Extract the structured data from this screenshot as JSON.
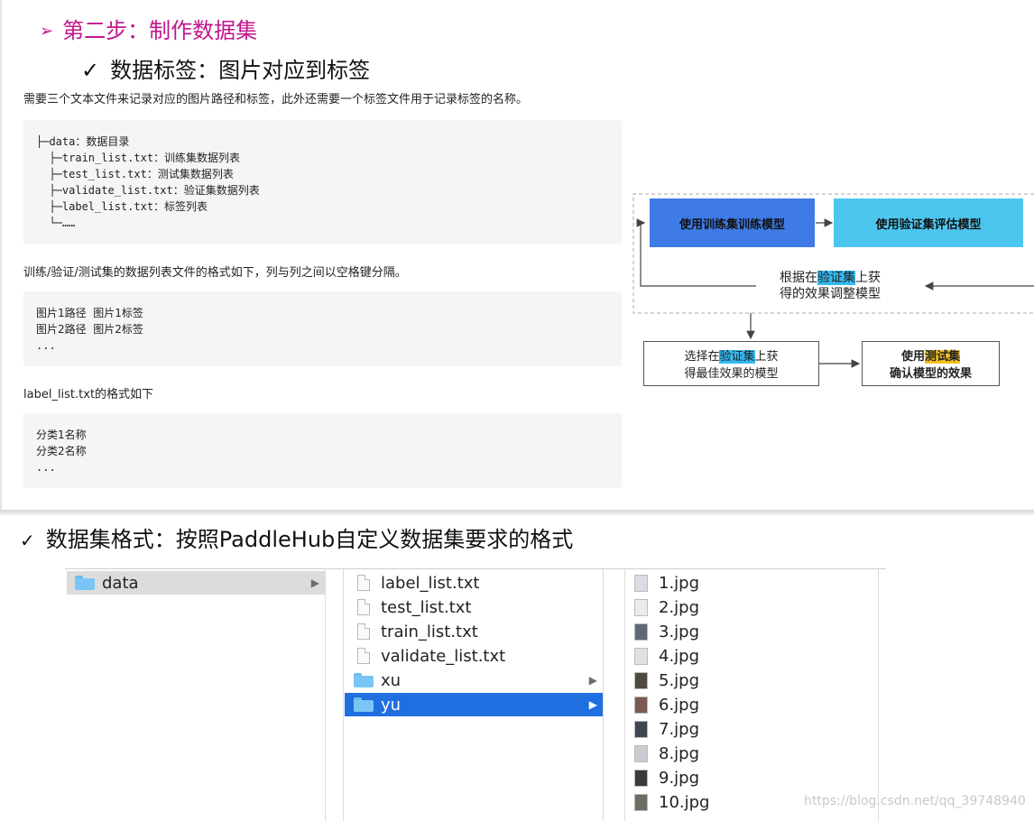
{
  "slide": {
    "step_arrow": "➢",
    "step_title": "第二步：制作数据集",
    "sub_check": "✓",
    "sub_title": "数据标签：图片对应到标签",
    "para1": "需要三个文本文件来记录对应的图片路径和标签，此外还需要一个标签文件用于记录标签的名称。",
    "tree_lines": [
      "├─data：数据目录",
      "  ├─train_list.txt：训练集数据列表",
      "  ├─test_list.txt：测试集数据列表",
      "  ├─validate_list.txt：验证集数据列表",
      "  ├─label_list.txt：标签列表",
      "  └─……"
    ],
    "para2": "训练/验证/测试集的数据列表文件的格式如下，列与列之间以空格键分隔。",
    "list_format_lines": [
      "图片1路径  图片1标签",
      "图片2路径  图片2标签",
      "..."
    ],
    "para3": "label_list.txt的格式如下",
    "label_format_lines": [
      "分类1名称",
      "分类2名称",
      "..."
    ]
  },
  "diagram": {
    "box_train": "使用训练集训练模型",
    "box_eval": "使用验证集评估模型",
    "note_line1_pre": "根据在",
    "note_line1_hl": "验证集",
    "note_line1_post": "上获",
    "note_line2": "得的效果调整模型",
    "box_select_line1_pre": "选择在",
    "box_select_line1_hl": "验证集",
    "box_select_line1_post": "上获",
    "box_select_line2": "得最佳效果的模型",
    "box_test_line1_pre": "使用",
    "box_test_line1_hl": "测试集",
    "box_test_line2": "确认模型的效果",
    "colors": {
      "train": "#3e7be6",
      "eval": "#4dc6ef",
      "highlight_blue": "#35b9ef",
      "highlight_yellow": "#f6c21b"
    }
  },
  "bottom": {
    "check": "✓",
    "title": "数据集格式：按照PaddleHub自定义数据集要求的格式"
  },
  "finder": {
    "col1": [
      {
        "name": "data",
        "icon": "folder-icon",
        "selected": true,
        "has_children": true
      }
    ],
    "col2": [
      {
        "name": "label_list.txt",
        "icon": "file-icon"
      },
      {
        "name": "test_list.txt",
        "icon": "file-icon"
      },
      {
        "name": "train_list.txt",
        "icon": "file-icon"
      },
      {
        "name": "validate_list.txt",
        "icon": "file-icon"
      },
      {
        "name": "xu",
        "icon": "folder-icon",
        "has_children": true
      },
      {
        "name": "yu",
        "icon": "folder-icon",
        "has_children": true,
        "selected": true
      }
    ],
    "col3": [
      "1.jpg",
      "2.jpg",
      "3.jpg",
      "4.jpg",
      "5.jpg",
      "6.jpg",
      "7.jpg",
      "8.jpg",
      "9.jpg",
      "10.jpg"
    ],
    "thumb_colors": [
      "#d9dde3",
      "#e9ecef",
      "#5d6a75",
      "#e3e0e4",
      "#4f4a3e",
      "#7a5a52",
      "#3f4652",
      "#c9ccd0",
      "#3b3b3b",
      "#6b6f63"
    ],
    "chevron": "▶",
    "colors": {
      "selection_blue": "#1f6fe0",
      "selection_gray": "#dcdcdc"
    }
  },
  "watermark": "https://blog.csdn.net/qq_39748940"
}
